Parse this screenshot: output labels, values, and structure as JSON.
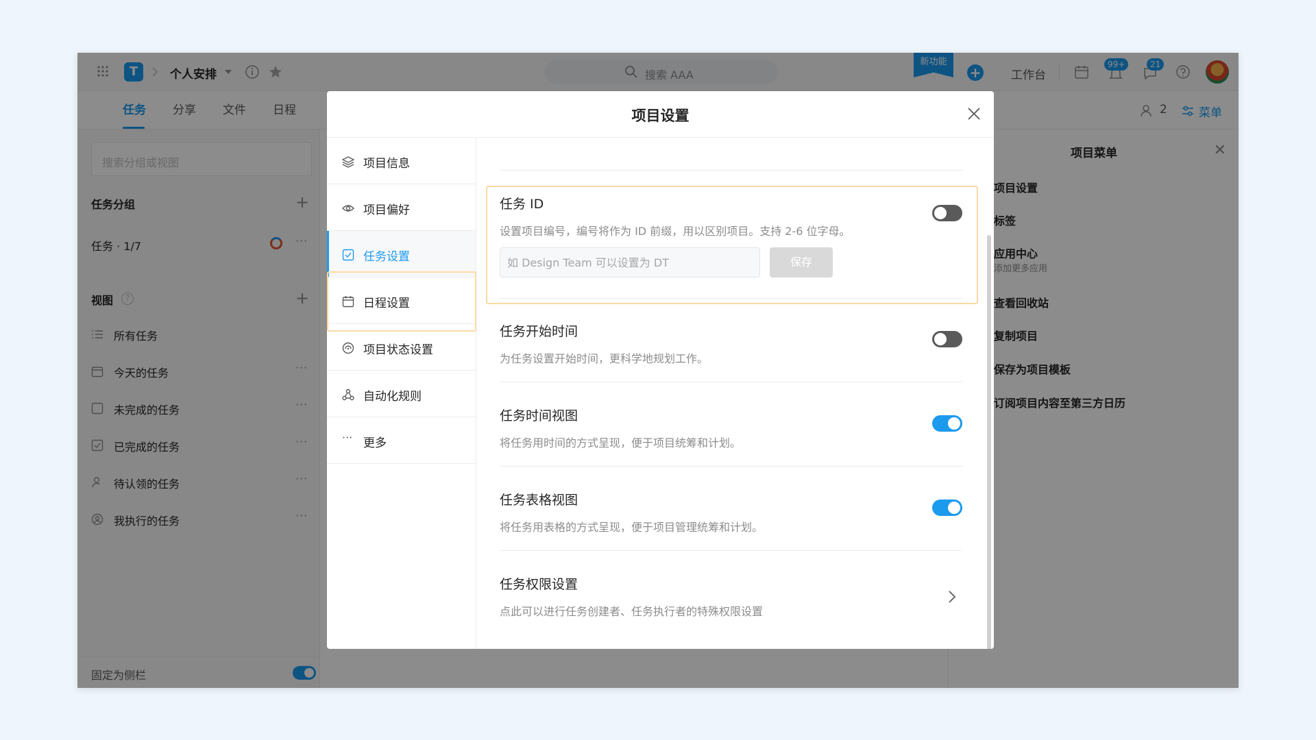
{
  "topbar": {
    "project_name": "个人安排",
    "search_placeholder": "搜索 AAA",
    "new_feature": "新功能",
    "workbench": "工作台",
    "badge_notifications": "99+",
    "badge_messages": "21"
  },
  "tabs": [
    "任务",
    "分享",
    "文件",
    "日程"
  ],
  "tabs_right": {
    "member_count": "2",
    "menu_label": "菜单"
  },
  "sidebar": {
    "search_placeholder": "搜索分组或视图",
    "group_header": "任务分组",
    "group_item": "任务 · 1/7",
    "views_header": "视图",
    "views": [
      "所有任务",
      "今天的任务",
      "未完成的任务",
      "已完成的任务",
      "待认领的任务",
      "我执行的任务"
    ],
    "footer": "固定为侧栏"
  },
  "right_panel": {
    "title": "项目菜单",
    "items": [
      "项目设置",
      "标签",
      "应用中心",
      "查看回收站",
      "复制项目",
      "保存为项目模板",
      "订阅项目内容至第三方日历"
    ],
    "app_center_sub": "添加更多应用"
  },
  "modal": {
    "title": "项目设置",
    "nav": [
      "项目信息",
      "项目偏好",
      "任务设置",
      "日程设置",
      "项目状态设置",
      "自动化规则",
      "更多"
    ],
    "active_nav": "任务设置",
    "task_id": {
      "title": "任务 ID",
      "desc": "设置项目编号，编号将作为 ID 前缀，用以区别项目。支持 2-6 位字母。",
      "placeholder": "如 Design Team 可以设置为 DT",
      "save": "保存",
      "enabled": false
    },
    "start_time": {
      "title": "任务开始时间",
      "desc": "为任务设置开始时间，更科学地规划工作。",
      "enabled": false
    },
    "timeline_view": {
      "title": "任务时间视图",
      "desc": "将任务用时间的方式呈现，便于项目统筹和计划。",
      "enabled": true
    },
    "table_view": {
      "title": "任务表格视图",
      "desc": "将任务用表格的方式呈现，便于项目管理统筹和计划。",
      "enabled": true
    },
    "permissions": {
      "title": "任务权限设置",
      "desc": "点此可以进行任务创建者、任务执行者的特殊权限设置"
    }
  },
  "colors": {
    "accent": "#1b9aee",
    "highlight": "#fcd9a4"
  }
}
